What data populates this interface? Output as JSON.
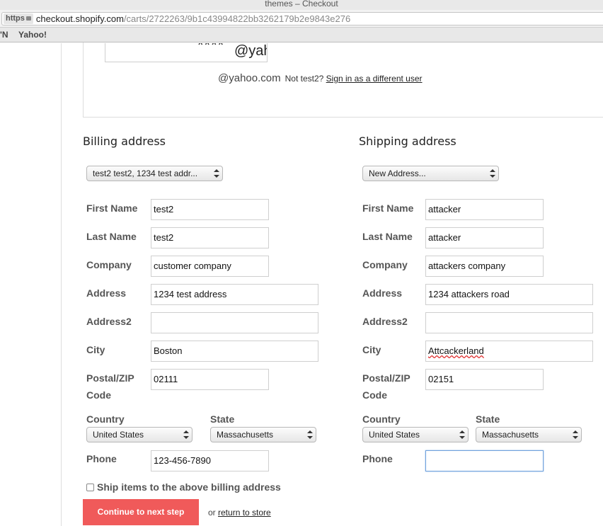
{
  "window": {
    "title": "themes – Checkout"
  },
  "address_bar": {
    "protocol": "https",
    "host": "checkout.shopify.com",
    "path": "/carts/2722263/9b1c43994822bb3262179b2e9843e276"
  },
  "bookmarks": {
    "left_partial": "'N",
    "items": [
      "Yahoo!"
    ]
  },
  "account": {
    "masked_email_fragment": "****",
    "email_at_fragment": "@yah",
    "email_domain": "@yahoo.com",
    "not_user_text": "Not test2?",
    "sign_in_link": "Sign in as a different user"
  },
  "billing": {
    "heading": "Billing address",
    "saved_address_select": "test2 test2, 1234 test addr...",
    "labels": {
      "first_name": "First Name",
      "last_name": "Last Name",
      "company": "Company",
      "address": "Address",
      "address2": "Address2",
      "city": "City",
      "postal_1": "Postal/ZIP",
      "postal_2": "Code",
      "country": "Country",
      "state": "State",
      "phone": "Phone"
    },
    "values": {
      "first_name": "test2",
      "last_name": "test2",
      "company": "customer company",
      "address": "1234 test address",
      "address2": "",
      "city": "Boston",
      "postal": "02111",
      "country": "United States",
      "state": "Massachusetts",
      "phone": "123-456-7890"
    }
  },
  "shipping": {
    "heading": "Shipping address",
    "saved_address_select": "New Address...",
    "labels": {
      "first_name": "First Name",
      "last_name": "Last Name",
      "company": "Company",
      "address": "Address",
      "address2": "Address2",
      "city": "City",
      "postal_1": "Postal/ZIP",
      "postal_2": "Code",
      "country": "Country",
      "state": "State",
      "phone": "Phone"
    },
    "values": {
      "first_name": "attacker",
      "last_name": "attacker",
      "company": "attackers company",
      "address": "1234 attackers road",
      "address2": "",
      "city": "Attcackerland",
      "postal": "02151",
      "country": "United States",
      "state": "Massachusetts",
      "phone": ""
    }
  },
  "ship_to_billing": {
    "label": "Ship items to the above billing address",
    "checked": false
  },
  "actions": {
    "continue_label": "Continue to next step",
    "or_text": "or",
    "return_link": "return to store"
  },
  "colors": {
    "primary_button": "#f05a5a",
    "focus_ring": "#6ea0dc"
  }
}
